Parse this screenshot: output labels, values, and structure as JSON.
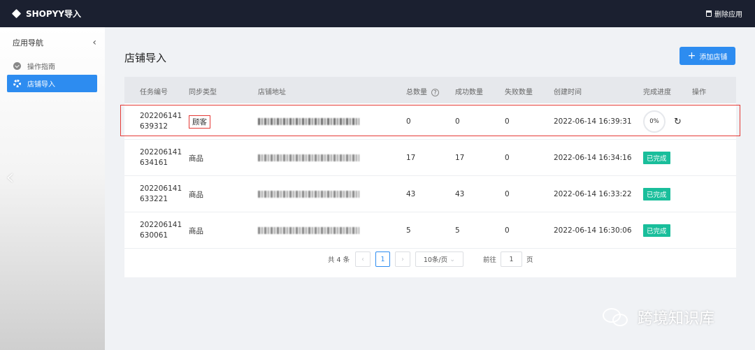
{
  "app": {
    "title": "SHOPYY导入",
    "delete_label": "删除应用"
  },
  "sidebar": {
    "heading": "应用导航",
    "items": [
      {
        "label": "操作指南",
        "icon": "check-circle-icon",
        "active": false
      },
      {
        "label": "店铺导入",
        "icon": "gear-icon",
        "active": true
      }
    ]
  },
  "main": {
    "title": "店铺导入",
    "add_button": "添加店铺",
    "columns": [
      "任务编号",
      "同步类型",
      "店铺地址",
      "总数量",
      "成功数量",
      "失败数量",
      "创建时间",
      "完成进度",
      "操作"
    ],
    "rows": [
      {
        "id": "202206141 639312",
        "id_line1": "202206141",
        "id_line2": "639312",
        "type": "顾客",
        "total": "0",
        "success": "0",
        "failed": "0",
        "created": "2022-06-14 16:39:31",
        "progress": "0%",
        "status": ""
      },
      {
        "id_line1": "202206141",
        "id_line2": "634161",
        "type": "商品",
        "total": "17",
        "success": "17",
        "failed": "0",
        "created": "2022-06-14 16:34:16",
        "status": "已完成"
      },
      {
        "id_line1": "202206141",
        "id_line2": "633221",
        "type": "商品",
        "total": "43",
        "success": "43",
        "failed": "0",
        "created": "2022-06-14 16:33:22",
        "status": "已完成"
      },
      {
        "id_line1": "202206141",
        "id_line2": "630061",
        "type": "商品",
        "total": "5",
        "success": "5",
        "failed": "0",
        "created": "2022-06-14 16:30:06",
        "status": "已完成"
      }
    ],
    "pagination": {
      "total_text": "共 4 条",
      "current_page": "1",
      "page_size": "10条/页",
      "goto_label": "前往",
      "goto_value": "1",
      "page_unit": "页"
    }
  },
  "watermark": {
    "text": "跨境知识库"
  },
  "colors": {
    "topbar": "#1b2030",
    "accent": "#2d8cf0",
    "done": "#19be9b",
    "highlight": "#e53935"
  }
}
